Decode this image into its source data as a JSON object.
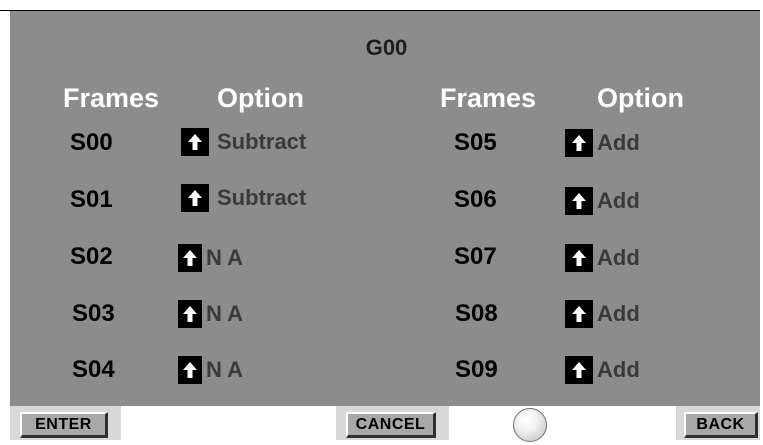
{
  "title": "G00",
  "headers": {
    "left_frames": "Frames",
    "left_option": "Option",
    "right_frames": "Frames",
    "right_option": "Option"
  },
  "left_rows": [
    {
      "frame": "S00",
      "option": "Subtract"
    },
    {
      "frame": "S01",
      "option": "Subtract"
    },
    {
      "frame": "S02",
      "option": "N A"
    },
    {
      "frame": "S03",
      "option": "N A"
    },
    {
      "frame": "S04",
      "option": "N A"
    }
  ],
  "right_rows": [
    {
      "frame": "S05",
      "option": "Add"
    },
    {
      "frame": "S06",
      "option": "Add"
    },
    {
      "frame": "S07",
      "option": "Add"
    },
    {
      "frame": "S08",
      "option": "Add"
    },
    {
      "frame": "S09",
      "option": "Add"
    }
  ],
  "buttons": {
    "enter": "ENTER",
    "cancel": "CANCEL",
    "back": "BACK"
  },
  "icons": {
    "option_toggle": "arrow-up-icon",
    "status": "status-indicator-light"
  },
  "colors": {
    "panel": "#8c8c8c",
    "header_text": "#ffffff",
    "frame_text": "#000000",
    "option_text": "#3a3a3a",
    "button_face": "#a8a8a8"
  }
}
